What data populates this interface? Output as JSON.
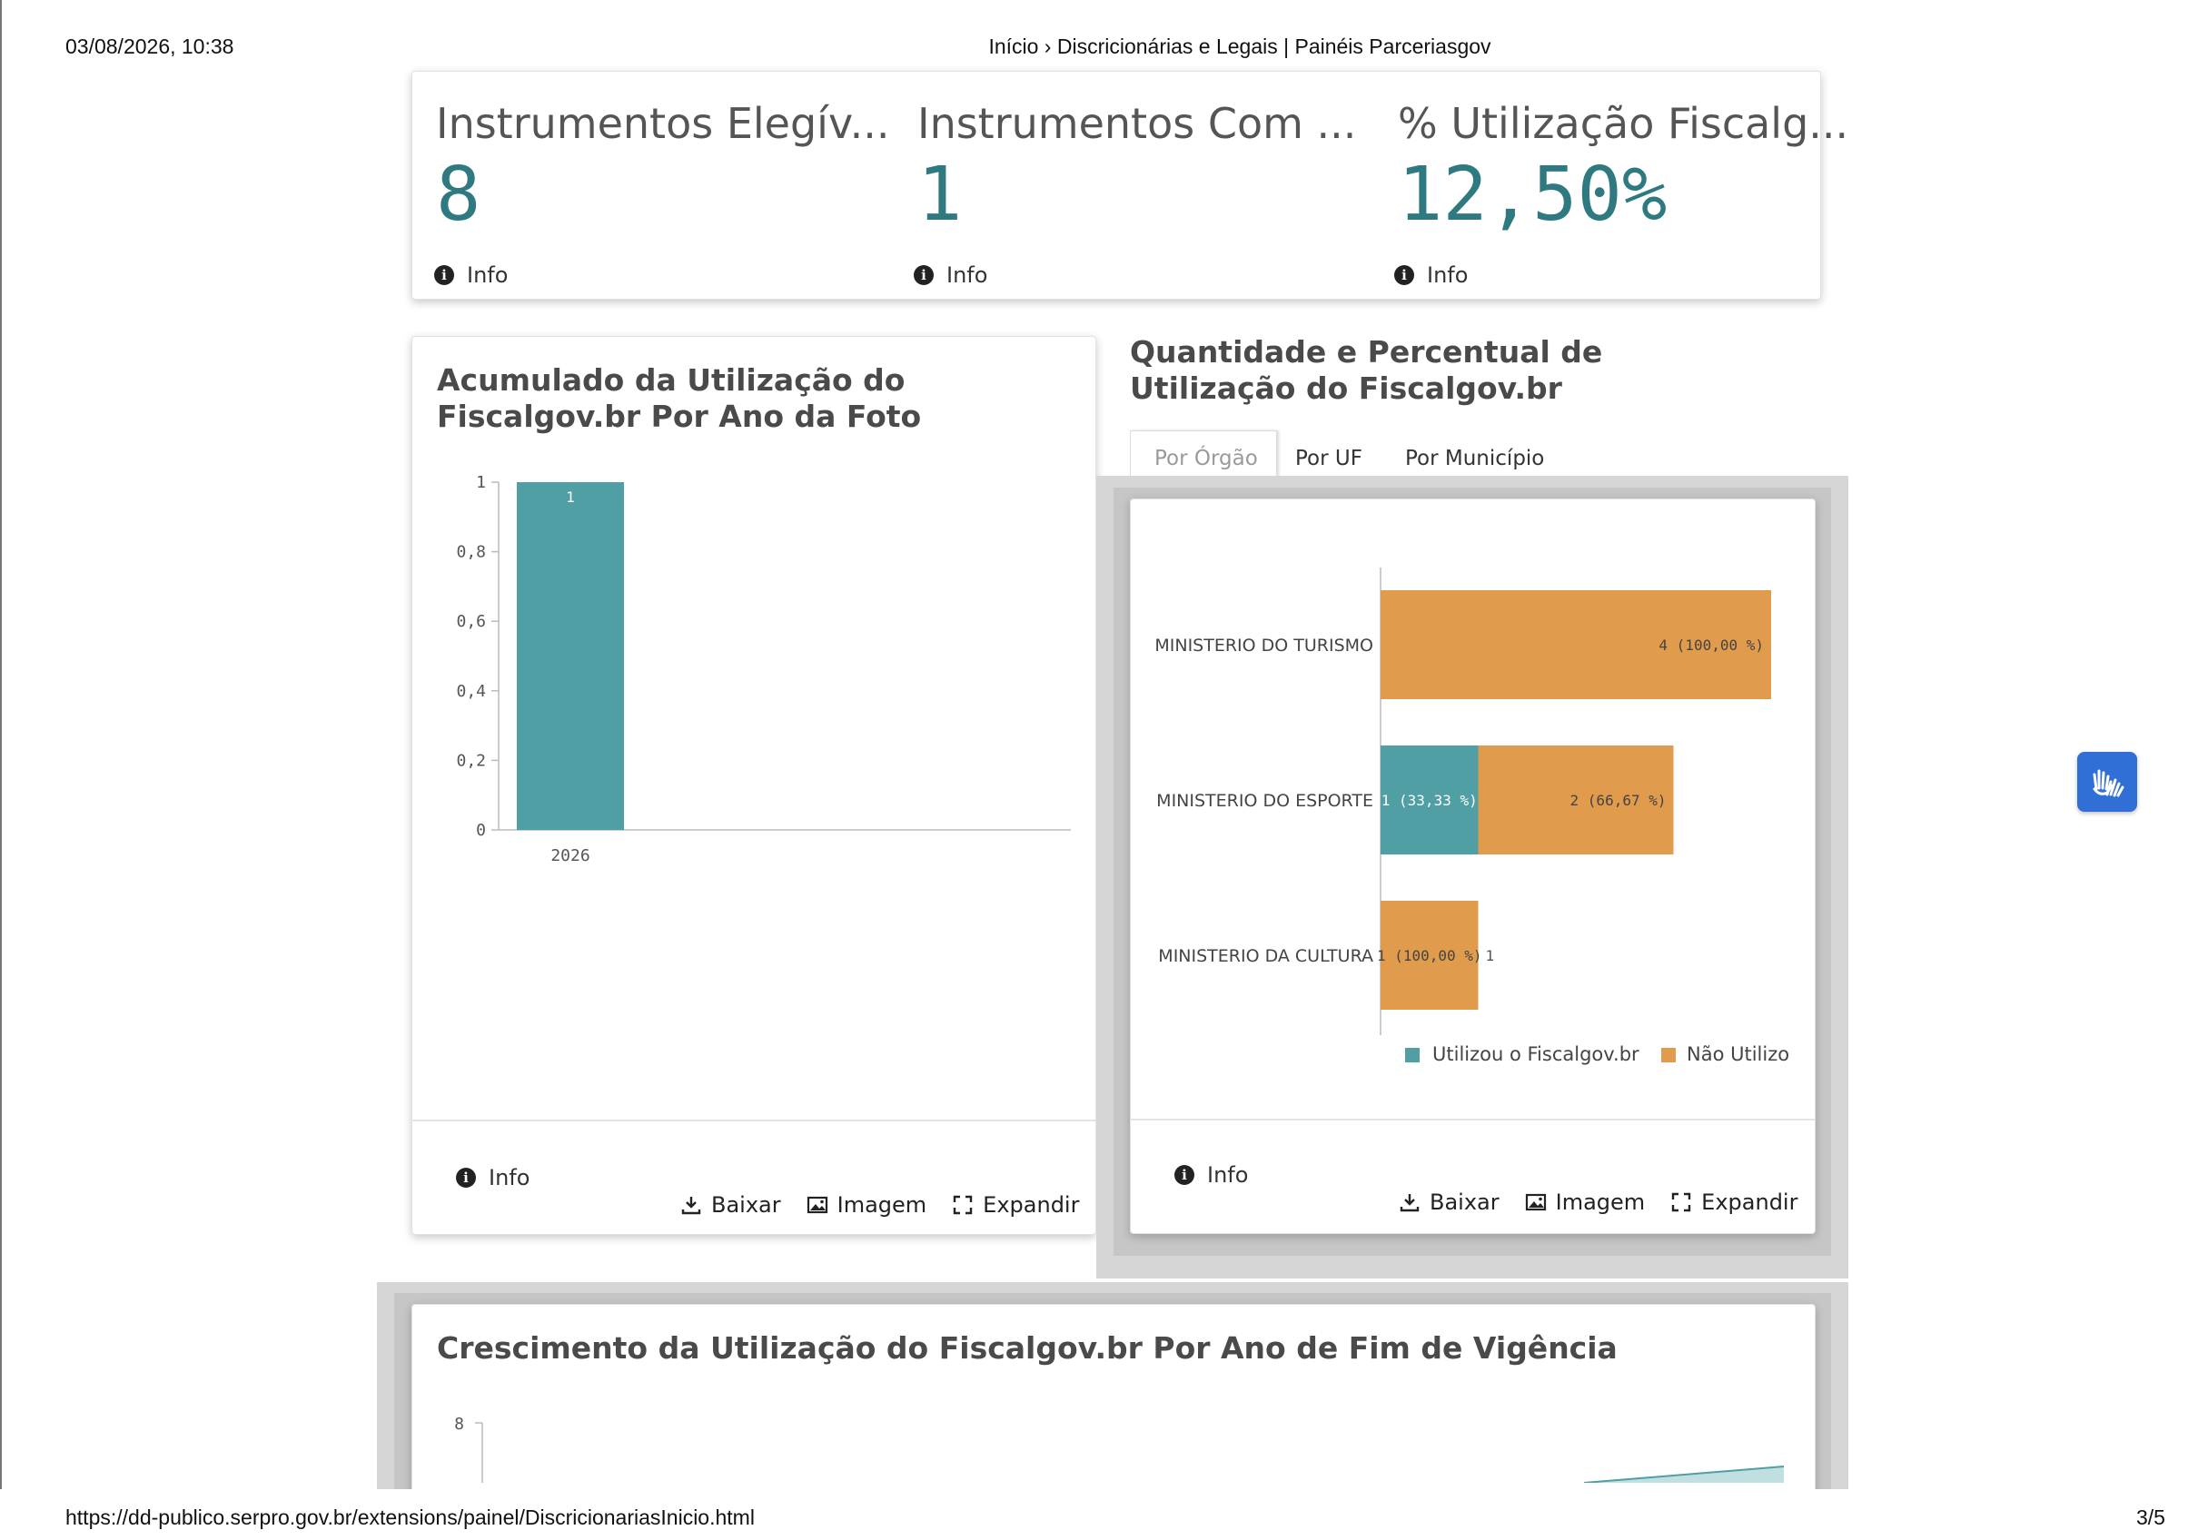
{
  "print": {
    "datetime": "03/08/2026, 10:38",
    "title": "Início › Discricionárias e Legais | Painéis Parceriasgov",
    "url": "https://dd-publico.serpro.gov.br/extensions/painel/DiscricionariasInicio.html",
    "page": "3/5"
  },
  "kpis": [
    {
      "title": "Instrumentos Elegív...",
      "value": "8",
      "info": "Info"
    },
    {
      "title": "Instrumentos Com ...",
      "value": "1",
      "info": "Info"
    },
    {
      "title": "% Utilização Fiscalg...",
      "value": "12,50%",
      "info": "Info"
    }
  ],
  "panel_left": {
    "title": "Acumulado da Utilização do Fiscalgov.br Por Ano da Foto",
    "info": "Info",
    "tools": {
      "download": "Baixar",
      "image": "Imagem",
      "expand": "Expandir"
    }
  },
  "panel_right": {
    "title": "Quantidade e Percentual de Utilização do Fiscalgov.br",
    "tabs": [
      "Por Órgão",
      "Por UF",
      "Por Município"
    ],
    "active_tab": "Por Órgão",
    "info": "Info",
    "tools": {
      "download": "Baixar",
      "image": "Imagem",
      "expand": "Expandir"
    },
    "legend": [
      "Utilizou o Fiscalgov.br",
      "Não Utilizo"
    ]
  },
  "panel_bottom": {
    "title": "Crescimento da Utilização do Fiscalgov.br Por Ano de Fim de Vigência"
  },
  "colors": {
    "teal": "#4f9fa5",
    "orange": "#e19b4c",
    "kpi": "#2f7a80",
    "accessibility": "#2f6fd6"
  },
  "chart_data": [
    {
      "type": "bar",
      "categories": [
        "2026"
      ],
      "values": [
        1
      ],
      "data_labels": [
        "1"
      ],
      "ylim": [
        0,
        1
      ],
      "yticks": [
        "0",
        "0,2",
        "0,4",
        "0,6",
        "0,8",
        "1"
      ],
      "ytick_values": [
        0,
        0.2,
        0.4,
        0.6,
        0.8,
        1
      ]
    },
    {
      "type": "bar",
      "orientation": "horizontal",
      "stacked": true,
      "categories": [
        "MINISTERIO DO TURISMO",
        "MINISTERIO DO ESPORTE",
        "MINISTERIO DA CULTURA"
      ],
      "series": [
        {
          "name": "Utilizou o Fiscalgov.br",
          "values": [
            0,
            1,
            0
          ],
          "labels": [
            "",
            "1 (33,33 %)",
            ""
          ]
        },
        {
          "name": "Não Utilizo",
          "values": [
            4,
            2,
            1
          ],
          "labels": [
            "4 (100,00 %)",
            "2 (66,67 %)",
            "1 (100,00 %)"
          ]
        }
      ],
      "totals": [
        "",
        "",
        "1"
      ],
      "legend": "bottom"
    },
    {
      "type": "area",
      "yticks": [
        "8"
      ],
      "ytick_values": [
        8
      ]
    }
  ]
}
